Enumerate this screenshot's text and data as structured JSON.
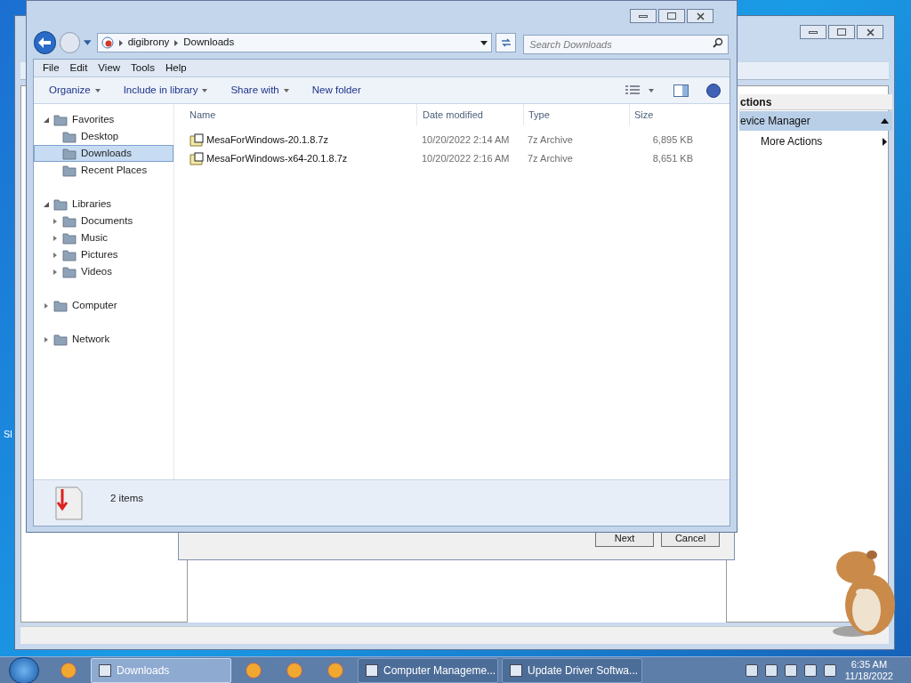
{
  "desktop_label": "Sl",
  "background_window": {
    "panel_title": "ctions",
    "section": "evice Manager",
    "action": "More Actions"
  },
  "dialog": {
    "buttons": [
      "Next",
      "Cancel"
    ]
  },
  "explorer": {
    "breadcrumb": [
      "digibrony",
      "Downloads"
    ],
    "search": {
      "placeholder": "Search Downloads"
    },
    "menu": [
      "File",
      "Edit",
      "View",
      "Tools",
      "Help"
    ],
    "toolbar": [
      {
        "label": "Organize",
        "dropdown": true
      },
      {
        "label": "Include in library",
        "dropdown": true
      },
      {
        "label": "Share with",
        "dropdown": true
      },
      {
        "label": "New folder",
        "dropdown": false
      }
    ],
    "nav": [
      {
        "label": "Favorites",
        "expanded": true,
        "selected": false,
        "children": [
          {
            "label": "Desktop",
            "selected": false
          },
          {
            "label": "Downloads",
            "selected": true
          },
          {
            "label": "Recent Places",
            "selected": false
          }
        ]
      },
      {
        "label": "Libraries",
        "expanded": true,
        "selected": false,
        "children": [
          {
            "label": "Documents",
            "expanded": false,
            "selected": false
          },
          {
            "label": "Music",
            "expanded": false,
            "selected": false
          },
          {
            "label": "Pictures",
            "expanded": false,
            "selected": false
          },
          {
            "label": "Videos",
            "expanded": false,
            "selected": false
          }
        ]
      },
      {
        "label": "Computer",
        "expanded": false,
        "selected": false
      },
      {
        "label": "Network",
        "expanded": false,
        "selected": false
      }
    ],
    "columns": [
      "Name",
      "Date modified",
      "Type",
      "Size"
    ],
    "rows": [
      {
        "name": "MesaForWindows-20.1.8.7z",
        "date": "10/20/2022 2:14 AM",
        "type": "7z Archive",
        "size": "6,895 KB"
      },
      {
        "name": "MesaForWindows-x64-20.1.8.7z",
        "date": "10/20/2022 2:16 AM",
        "type": "7z Archive",
        "size": "8,651 KB"
      }
    ],
    "status": "2 items"
  },
  "taskbar": {
    "items": [
      {
        "kind": "icon"
      },
      {
        "kind": "task",
        "label": "Downloads",
        "selected": true
      },
      {
        "kind": "icon"
      },
      {
        "kind": "icon"
      },
      {
        "kind": "icon"
      },
      {
        "kind": "task",
        "label": "Computer Manageme...",
        "selected": false
      },
      {
        "kind": "task",
        "label": "Update Driver Softwa...",
        "selected": false
      }
    ],
    "time": "6:35 AM",
    "date": "11/18/2022"
  }
}
